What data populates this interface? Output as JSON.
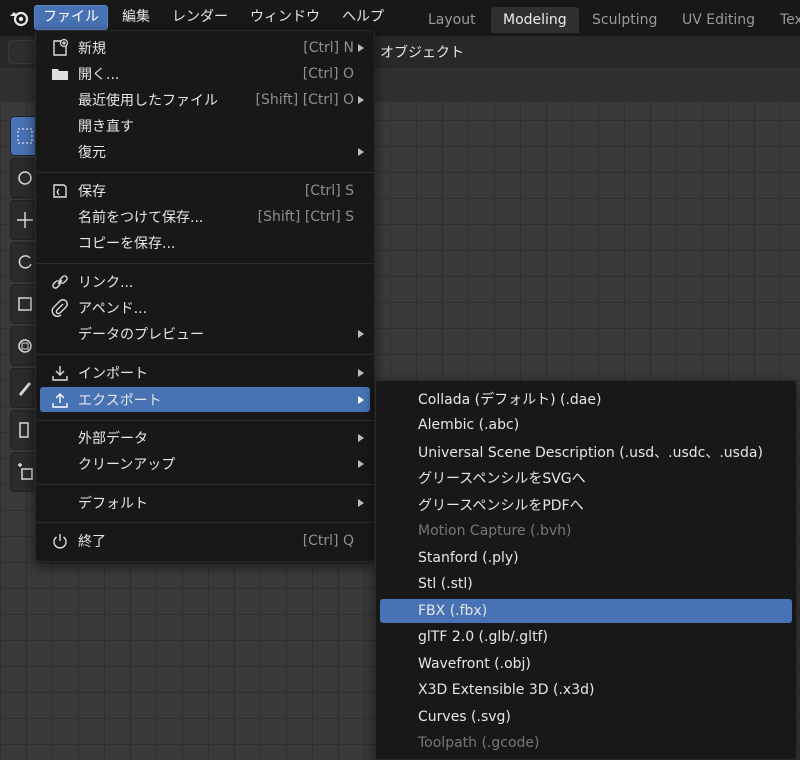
{
  "topbar": {
    "menus": [
      "ファイル",
      "編集",
      "レンダー",
      "ウィンドウ",
      "ヘルプ"
    ],
    "workspaces": [
      "Layout",
      "Modeling",
      "Sculpting",
      "UV Editing",
      "Tex"
    ],
    "active_workspace": "Modeling"
  },
  "header": {
    "object_label": "オブジェクト"
  },
  "file_menu": {
    "items": [
      {
        "label": "新規",
        "shortcut": "[Ctrl] N",
        "submenu": true,
        "icon": "new-file-icon"
      },
      {
        "label": "開く...",
        "shortcut": "[Ctrl] O",
        "submenu": false,
        "icon": "folder-icon"
      },
      {
        "label": "最近使用したファイル",
        "shortcut": "[Shift] [Ctrl] O",
        "submenu": true,
        "icon": ""
      },
      {
        "label": "開き直す",
        "shortcut": "",
        "submenu": false,
        "icon": ""
      },
      {
        "label": "復元",
        "shortcut": "",
        "submenu": true,
        "icon": ""
      },
      {
        "label": "保存",
        "shortcut": "[Ctrl] S",
        "submenu": false,
        "icon": "save-icon"
      },
      {
        "label": "名前をつけて保存...",
        "shortcut": "[Shift] [Ctrl] S",
        "submenu": false,
        "icon": ""
      },
      {
        "label": "コピーを保存...",
        "shortcut": "",
        "submenu": false,
        "icon": ""
      },
      {
        "label": "リンク...",
        "shortcut": "",
        "submenu": false,
        "icon": "link-icon"
      },
      {
        "label": "アペンド...",
        "shortcut": "",
        "submenu": false,
        "icon": "append-icon"
      },
      {
        "label": "データのプレビュー",
        "shortcut": "",
        "submenu": true,
        "icon": ""
      },
      {
        "label": "インポート",
        "shortcut": "",
        "submenu": true,
        "icon": "import-icon"
      },
      {
        "label": "エクスポート",
        "shortcut": "",
        "submenu": true,
        "icon": "export-icon"
      },
      {
        "label": "外部データ",
        "shortcut": "",
        "submenu": true,
        "icon": ""
      },
      {
        "label": "クリーンアップ",
        "shortcut": "",
        "submenu": true,
        "icon": ""
      },
      {
        "label": "デフォルト",
        "shortcut": "",
        "submenu": true,
        "icon": ""
      },
      {
        "label": "終了",
        "shortcut": "[Ctrl] Q",
        "submenu": false,
        "icon": "power-icon"
      }
    ]
  },
  "export_menu": {
    "items": [
      {
        "label": "Collada (デフォルト) (.dae)",
        "disabled": false
      },
      {
        "label": "Alembic (.abc)",
        "disabled": false
      },
      {
        "label": "Universal Scene Description (.usd、.usdc、.usda)",
        "disabled": false
      },
      {
        "label": "グリースペンシルをSVGへ",
        "disabled": false
      },
      {
        "label": "グリースペンシルをPDFへ",
        "disabled": false
      },
      {
        "label": "Motion Capture (.bvh)",
        "disabled": true
      },
      {
        "label": "Stanford (.ply)",
        "disabled": false
      },
      {
        "label": "Stl (.stl)",
        "disabled": false
      },
      {
        "label": "FBX (.fbx)",
        "disabled": false
      },
      {
        "label": "glTF 2.0 (.glb/.gltf)",
        "disabled": false
      },
      {
        "label": "Wavefront (.obj)",
        "disabled": false
      },
      {
        "label": "X3D Extensible 3D (.x3d)",
        "disabled": false
      },
      {
        "label": "Curves (.svg)",
        "disabled": false
      },
      {
        "label": "Toolpath (.gcode)",
        "disabled": true
      }
    ]
  },
  "colors": {
    "highlight": "#4772b3",
    "menu_bg": "#181818"
  }
}
